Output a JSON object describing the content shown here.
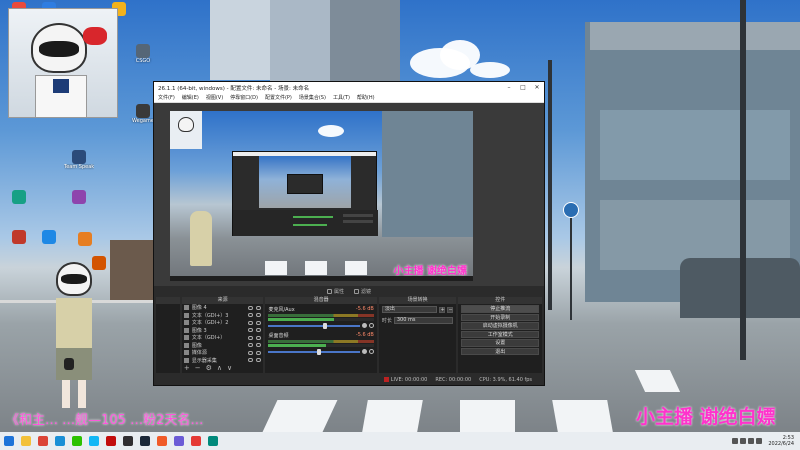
{
  "desktop": {
    "icons": [
      {
        "label": "",
        "color": "#e94b3c"
      },
      {
        "label": "",
        "color": "#2f7de1"
      },
      {
        "label": "",
        "color": "#f2b21c"
      },
      {
        "label": "CSGO",
        "color": "#556677"
      },
      {
        "label": "Wegame",
        "color": "#3a3a3a"
      },
      {
        "label": "Team Speak",
        "color": "#2b4b7a"
      },
      {
        "label": "",
        "color": "#c0392b"
      },
      {
        "label": "",
        "color": "#1e88e5"
      },
      {
        "label": "",
        "color": "#8e44ad"
      },
      {
        "label": "",
        "color": "#16a085"
      },
      {
        "label": "",
        "color": "#e67e22"
      },
      {
        "label": "",
        "color": "#d35400"
      }
    ]
  },
  "obs": {
    "title": "26.1.1 (64-bit, windows) - 配置文件: 未命名 - 场景: 未命名",
    "menu": [
      "文件(F)",
      "编辑(E)",
      "视图(V)",
      "停靠窗口(D)",
      "配置文件(P)",
      "场景集合(S)",
      "工具(T)",
      "帮助(H)"
    ],
    "preview_caption": "小主播 谢绝白嫖",
    "toolbar": [
      "属性",
      "滤镜"
    ],
    "docks": {
      "scenes_title": "",
      "sources_title": "来源",
      "mixer_title": "混音器",
      "transitions_title": "场景转换",
      "controls_title": "控件"
    },
    "sources": [
      {
        "name": "图像 4",
        "type": "image"
      },
      {
        "name": "文本（GDI+）3",
        "type": "text"
      },
      {
        "name": "文本（GDI+）2",
        "type": "text"
      },
      {
        "name": "图像 3",
        "type": "image"
      },
      {
        "name": "文本（GDI+）",
        "type": "text"
      },
      {
        "name": "图像",
        "type": "image"
      },
      {
        "name": "媒体源",
        "type": "media"
      },
      {
        "name": "显示器采集",
        "type": "display"
      }
    ],
    "mixer": [
      {
        "name": "麦克风/Aux",
        "db": "-5.6 dB",
        "level": 0.62
      },
      {
        "name": "桌面音频",
        "db": "-5.6 dB",
        "level": 0.55
      }
    ],
    "transitions": {
      "type": "淡出",
      "duration_label": "时长",
      "duration_value": "300 ms"
    },
    "controls": [
      "停止推流",
      "开始录制",
      "启动虚拟摄像机",
      "工作室模式",
      "设置",
      "退出"
    ],
    "status": {
      "live_label": "LIVE:",
      "live_time": "00:00:00",
      "rec_label": "REC:",
      "rec_time": "00:00:00",
      "cpu": "CPU: 3.9%, 61.40 fps"
    }
  },
  "overlay": {
    "caption_left": "《和主…   …舰—105  …粉2天名…",
    "caption_right": "小主播 谢绝白嫖"
  },
  "taskbar": {
    "apps": [
      {
        "name": "start",
        "color": "#1e73d8"
      },
      {
        "name": "file-explorer",
        "color": "#f3c13a"
      },
      {
        "name": "chrome",
        "color": "#db4437"
      },
      {
        "name": "edge",
        "color": "#1a8fd6"
      },
      {
        "name": "wechat",
        "color": "#2dc100"
      },
      {
        "name": "qq",
        "color": "#12b7f5"
      },
      {
        "name": "netease-music",
        "color": "#c20c0c"
      },
      {
        "name": "obs",
        "color": "#302e31"
      },
      {
        "name": "steam",
        "color": "#1b2838"
      },
      {
        "name": "app",
        "color": "#f05a28"
      },
      {
        "name": "app2",
        "color": "#6b5bd6"
      },
      {
        "name": "app3",
        "color": "#e53935"
      },
      {
        "name": "app4",
        "color": "#00897b"
      }
    ],
    "clock_time": "2:53",
    "clock_date": "2022/6/24"
  }
}
